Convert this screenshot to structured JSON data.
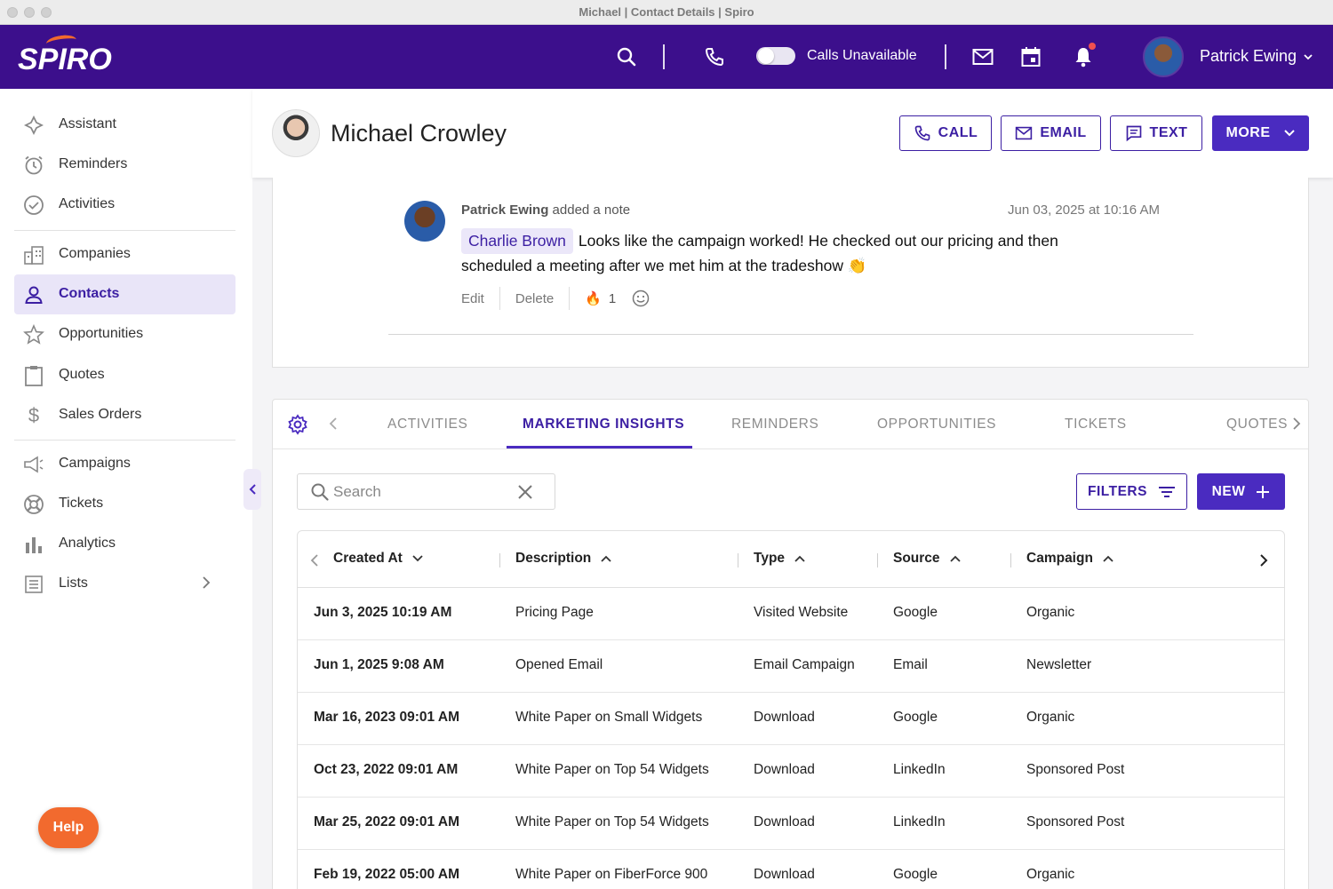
{
  "window": {
    "title": "Michael | Contact Details | Spiro"
  },
  "topnav": {
    "logo": "SPIRO",
    "calls_label": "Calls Unavailable",
    "user_name": "Patrick Ewing"
  },
  "sidebar": {
    "items": [
      {
        "label": "Assistant",
        "icon": "assistant-icon"
      },
      {
        "label": "Reminders",
        "icon": "alarm-clock-icon"
      },
      {
        "label": "Activities",
        "icon": "check-circle-icon"
      },
      {
        "label": "Companies",
        "icon": "building-icon"
      },
      {
        "label": "Contacts",
        "icon": "person-icon",
        "active": true
      },
      {
        "label": "Opportunities",
        "icon": "star-icon"
      },
      {
        "label": "Quotes",
        "icon": "clipboard-icon"
      },
      {
        "label": "Sales Orders",
        "icon": "dollar-icon"
      },
      {
        "label": "Campaigns",
        "icon": "megaphone-icon"
      },
      {
        "label": "Tickets",
        "icon": "lifebuoy-icon"
      },
      {
        "label": "Analytics",
        "icon": "bar-chart-icon"
      },
      {
        "label": "Lists",
        "icon": "list-icon"
      }
    ],
    "help_label": "Help"
  },
  "contact": {
    "name": "Michael Crowley",
    "buttons": {
      "call": "CALL",
      "email": "EMAIL",
      "text": "TEXT",
      "more": "MORE"
    }
  },
  "note": {
    "author": "Patrick Ewing",
    "action": "added a note",
    "date": "Jun 03, 2025 at 10:16 AM",
    "mention": "Charlie Brown",
    "text": "Looks like the campaign worked! He checked out our pricing and then scheduled a meeting after we met him at the tradeshow",
    "emoji": "👏",
    "edit_label": "Edit",
    "delete_label": "Delete",
    "reaction_emoji": "🔥",
    "reaction_count": "1"
  },
  "tabs": {
    "items": [
      "ACTIVITIES",
      "MARKETING INSIGHTS",
      "REMINDERS",
      "OPPORTUNITIES",
      "TICKETS",
      "QUOTES"
    ],
    "active": "MARKETING INSIGHTS"
  },
  "toolbar": {
    "search_placeholder": "Search",
    "filters_label": "FILTERS",
    "new_label": "NEW"
  },
  "table": {
    "columns": [
      "Created At",
      "Description",
      "Type",
      "Source",
      "Campaign"
    ],
    "rows": [
      [
        "Jun 3, 2025 10:19 AM",
        "Pricing Page",
        "Visited Website",
        "Google",
        "Organic"
      ],
      [
        "Jun 1, 2025 9:08 AM",
        "Opened Email",
        "Email Campaign",
        "Email",
        "Newsletter"
      ],
      [
        "Mar 16, 2023 09:01 AM",
        "White Paper on Small Widgets",
        "Download",
        "Google",
        "Organic"
      ],
      [
        "Oct 23, 2022 09:01 AM",
        "White Paper on Top 54 Widgets",
        "Download",
        "LinkedIn",
        "Sponsored Post"
      ],
      [
        "Mar 25, 2022 09:01 AM",
        "White Paper on Top 54 Widgets",
        "Download",
        "LinkedIn",
        "Sponsored Post"
      ],
      [
        "Feb 19, 2022 05:00 AM",
        "White Paper on FiberForce 900",
        "Download",
        "Google",
        "Organic"
      ]
    ]
  },
  "colors": {
    "brand": "#3c0f8c",
    "accent": "#4a2bc0",
    "help": "#f26a2e"
  }
}
